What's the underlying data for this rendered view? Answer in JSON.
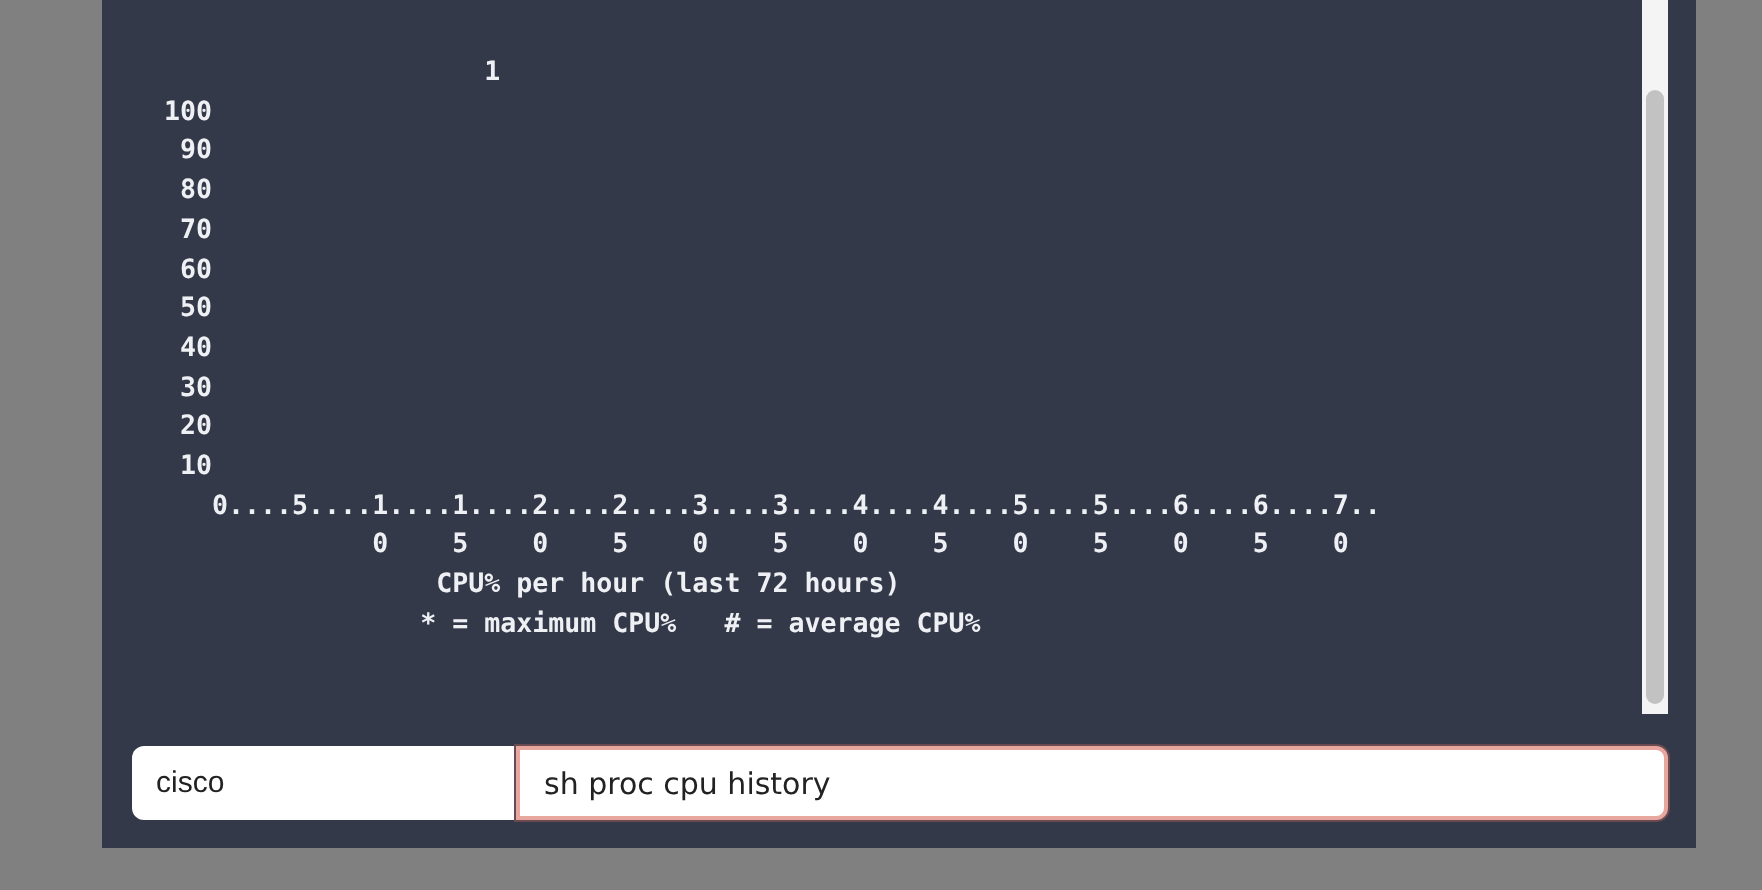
{
  "terminal": {
    "lines": [
      "                    1",
      "100",
      " 90",
      " 80",
      " 70",
      " 60",
      " 50",
      " 40",
      " 30",
      " 20",
      " 10",
      "   0....5....1....1....2....2....3....3....4....4....5....5....6....6....7..",
      "             0    5    0    5    0    5    0    5    0    5    0    5    0",
      "                 CPU% per hour (last 72 hours)",
      "                * = maximum CPU%   # = average CPU%"
    ]
  },
  "command_bar": {
    "host": "cisco",
    "command": {
      "value": "sh proc cpu history",
      "focused": true
    }
  }
}
